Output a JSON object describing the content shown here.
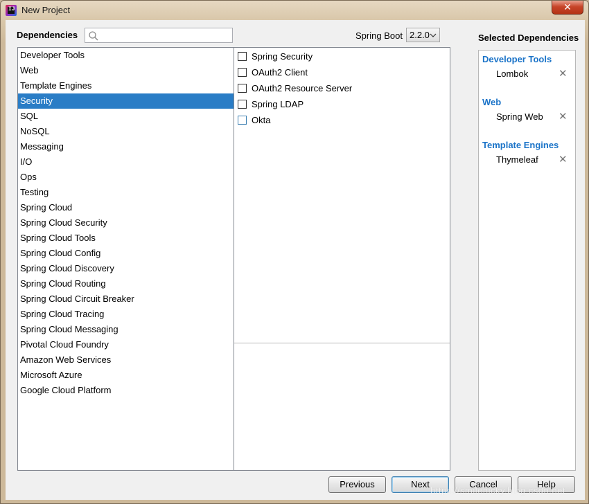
{
  "window": {
    "title": "New Project",
    "close_glyph": "✕"
  },
  "header": {
    "dependencies_label": "Dependencies",
    "search_placeholder": "",
    "search_value": "",
    "spring_boot_label": "Spring Boot",
    "spring_boot_version": "2.2.0",
    "selected_label": "Selected Dependencies"
  },
  "categories": [
    "Developer Tools",
    "Web",
    "Template Engines",
    "Security",
    "SQL",
    "NoSQL",
    "Messaging",
    "I/O",
    "Ops",
    "Testing",
    "Spring Cloud",
    "Spring Cloud Security",
    "Spring Cloud Tools",
    "Spring Cloud Config",
    "Spring Cloud Discovery",
    "Spring Cloud Routing",
    "Spring Cloud Circuit Breaker",
    "Spring Cloud Tracing",
    "Spring Cloud Messaging",
    "Pivotal Cloud Foundry",
    "Amazon Web Services",
    "Microsoft Azure",
    "Google Cloud Platform"
  ],
  "selected_category_index": 3,
  "dependencies": [
    {
      "label": "Spring Security",
      "checked": false
    },
    {
      "label": "OAuth2 Client",
      "checked": false
    },
    {
      "label": "OAuth2 Resource Server",
      "checked": false
    },
    {
      "label": "Spring LDAP",
      "checked": false
    },
    {
      "label": "Okta",
      "checked": false
    }
  ],
  "selected_groups": [
    {
      "title": "Developer Tools",
      "items": [
        "Lombok"
      ]
    },
    {
      "title": "Web",
      "items": [
        "Spring Web"
      ]
    },
    {
      "title": "Template Engines",
      "items": [
        "Thymeleaf"
      ]
    }
  ],
  "remove_glyph": "✕",
  "buttons": {
    "previous": "Previous",
    "next": "Next",
    "cancel": "Cancel",
    "help": "Help"
  },
  "watermark": "https://smilenicky.blog.csdn.net",
  "colors": {
    "selection": "#2a7dc6",
    "group_title": "#1a73c8"
  },
  "icons": {
    "app": "intellij-idea-icon",
    "search": "search-icon",
    "dropdown": "chevron-down-icon",
    "remove": "close-icon"
  }
}
